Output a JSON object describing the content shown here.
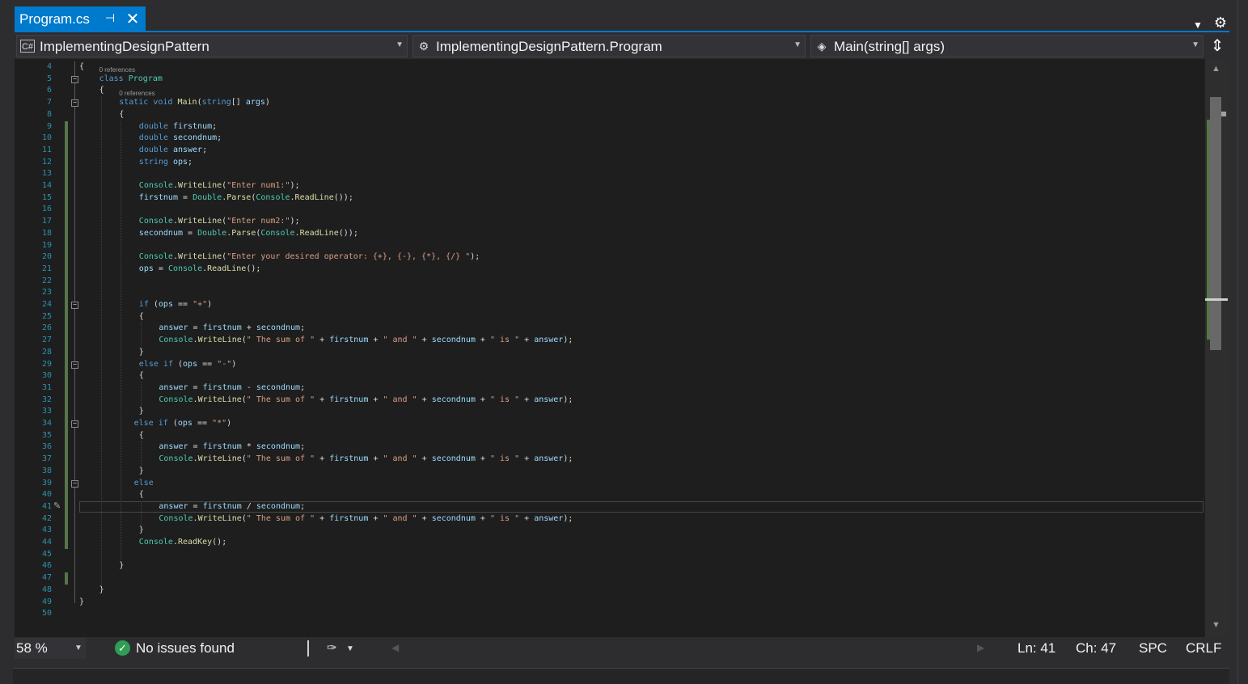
{
  "tab": {
    "title": "Program.cs",
    "pin_icon": "pin-icon",
    "close_icon": "close-icon",
    "close_glyph": "✕",
    "pin_glyph": "⊣"
  },
  "nav": {
    "project": "ImplementingDesignPattern",
    "project_icon": "C#",
    "type": "ImplementingDesignPattern.Program",
    "member": "Main(string[] args)"
  },
  "code": {
    "lines": [
      {
        "n": "4",
        "t": "{",
        "x": 0
      },
      {
        "n": "5",
        "t": "class Program",
        "x": 1
      },
      {
        "n": "6",
        "t": "{",
        "x": 1
      },
      {
        "n": "7",
        "t": "static void Main(string[] args)",
        "x": 2
      },
      {
        "n": "8",
        "t": "{",
        "x": 2
      },
      {
        "n": "9",
        "t": "double firstnum;",
        "x": 3
      },
      {
        "n": "10",
        "t": "double secondnum;",
        "x": 3
      },
      {
        "n": "11",
        "t": "double answer;",
        "x": 3
      },
      {
        "n": "12",
        "t": "string ops;",
        "x": 3
      },
      {
        "n": "13",
        "t": "",
        "x": 3
      },
      {
        "n": "14",
        "t": "Console.WriteLine(\"Enter num1:\");",
        "x": 3
      },
      {
        "n": "15",
        "t": "firstnum = Double.Parse(Console.ReadLine());",
        "x": 3
      },
      {
        "n": "16",
        "t": "",
        "x": 3
      },
      {
        "n": "17",
        "t": "Console.WriteLine(\"Enter num2:\");",
        "x": 3
      },
      {
        "n": "18",
        "t": "secondnum = Double.Parse(Console.ReadLine());",
        "x": 3
      },
      {
        "n": "19",
        "t": "",
        "x": 3
      },
      {
        "n": "20",
        "t": "Console.WriteLine(\"Enter your desired operator: {+}, {-}, {*}, {/} \");",
        "x": 3
      },
      {
        "n": "21",
        "t": "ops = Console.ReadLine();",
        "x": 3
      },
      {
        "n": "22",
        "t": "",
        "x": 3
      },
      {
        "n": "23",
        "t": "",
        "x": 3
      },
      {
        "n": "24",
        "t": "if (ops == \"+\")",
        "x": 3
      },
      {
        "n": "25",
        "t": "{",
        "x": 3
      },
      {
        "n": "26",
        "t": "answer = firstnum + secondnum;",
        "x": 4
      },
      {
        "n": "27",
        "t": "Console.WriteLine(\" The sum of \" + firstnum + \" and \" + secondnum + \" is \" + answer);",
        "x": 4
      },
      {
        "n": "28",
        "t": "}",
        "x": 3
      },
      {
        "n": "29",
        "t": "else if (ops == \"-\")",
        "x": 3
      },
      {
        "n": "30",
        "t": "{",
        "x": 3
      },
      {
        "n": "31",
        "t": "answer = firstnum - secondnum;",
        "x": 4
      },
      {
        "n": "32",
        "t": "Console.WriteLine(\" The sum of \" + firstnum + \" and \" + secondnum + \" is \" + answer);",
        "x": 4
      },
      {
        "n": "33",
        "t": "}",
        "x": 3
      },
      {
        "n": "34",
        "t": "else if (ops == \"*\")",
        "x": 2.75
      },
      {
        "n": "35",
        "t": "{",
        "x": 3
      },
      {
        "n": "36",
        "t": "answer = firstnum * secondnum;",
        "x": 4
      },
      {
        "n": "37",
        "t": "Console.WriteLine(\" The sum of \" + firstnum + \" and \" + secondnum + \" is \" + answer);",
        "x": 4
      },
      {
        "n": "38",
        "t": "}",
        "x": 3
      },
      {
        "n": "39",
        "t": "else",
        "x": 2.75
      },
      {
        "n": "40",
        "t": "{",
        "x": 3
      },
      {
        "n": "41",
        "t": "answer = firstnum / secondnum;",
        "x": 4
      },
      {
        "n": "42",
        "t": "Console.WriteLine(\" The sum of \" + firstnum + \" and \" + secondnum + \" is \" + answer);",
        "x": 4
      },
      {
        "n": "43",
        "t": "}",
        "x": 3
      },
      {
        "n": "44",
        "t": "Console.ReadKey();",
        "x": 3
      },
      {
        "n": "45",
        "t": "",
        "x": 3
      },
      {
        "n": "46",
        "t": "}",
        "x": 2
      },
      {
        "n": "47",
        "t": "",
        "x": 2
      },
      {
        "n": "48",
        "t": "}",
        "x": 1
      },
      {
        "n": "49",
        "t": "}",
        "x": 0
      },
      {
        "n": "50",
        "t": "",
        "x": 0
      }
    ],
    "codelens": [
      {
        "before_line": "5",
        "text": "0 references"
      },
      {
        "before_line": "7",
        "text": "0 references"
      }
    ],
    "fold_lines": [
      "5",
      "7",
      "24",
      "29",
      "34",
      "39"
    ],
    "changed_ranges": [
      [
        "9",
        "44"
      ],
      [
        "47",
        "47"
      ]
    ],
    "current_line": "41",
    "keywords": [
      "class",
      "static",
      "void",
      "string",
      "double",
      "if",
      "else"
    ],
    "types": [
      "Program",
      "Console",
      "Double"
    ],
    "methods": [
      "Main",
      "WriteLine",
      "Parse",
      "ReadLine",
      "ReadKey"
    ]
  },
  "status": {
    "zoom": "58 %",
    "issues": "No issues found",
    "ln": "Ln: 41",
    "ch": "Ch: 47",
    "spc": "SPC",
    "crlf": "CRLF"
  },
  "icons": {
    "settings": "gear-icon",
    "split": "split-window-icon",
    "check": "check-circle-icon",
    "cleanup": "code-cleanup-icon"
  },
  "colors": {
    "accent": "#007acc",
    "line_number": "#2b91af",
    "keyword": "#569cd6",
    "type": "#4ec9b0",
    "string": "#d69d85",
    "change_marker": "#57744a"
  }
}
